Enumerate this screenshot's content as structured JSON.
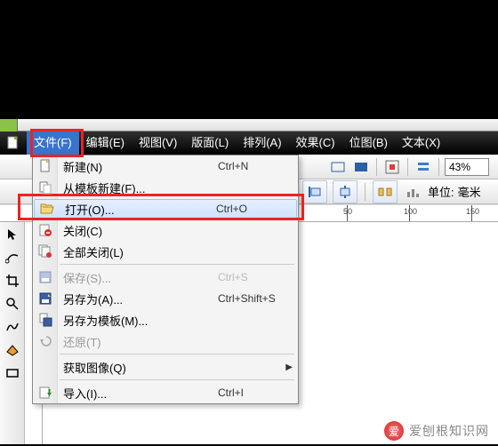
{
  "menubar": {
    "file": "文件(F)",
    "edit": "编辑(E)",
    "view": "视图(V)",
    "layout": "版面(L)",
    "arrange": "排列(A)",
    "effects": "效果(C)",
    "bitmap": "位图(B)",
    "text": "文本(X)"
  },
  "file_menu": {
    "new": {
      "label": "新建(N)",
      "shortcut": "Ctrl+N"
    },
    "new_from_template": {
      "label": "从模板新建(F)...",
      "shortcut": ""
    },
    "open": {
      "label": "打开(O)...",
      "shortcut": "Ctrl+O"
    },
    "close": {
      "label": "关闭(C)",
      "shortcut": ""
    },
    "close_all": {
      "label": "全部关闭(L)",
      "shortcut": ""
    },
    "save": {
      "label": "保存(S)...",
      "shortcut": "Ctrl+S"
    },
    "save_as": {
      "label": "另存为(A)...",
      "shortcut": "Ctrl+Shift+S"
    },
    "save_as_template": {
      "label": "另存为模板(M)...",
      "shortcut": ""
    },
    "revert": {
      "label": "还原(T)",
      "shortcut": ""
    },
    "acquire_image": {
      "label": "获取图像(Q)",
      "shortcut": ""
    },
    "import": {
      "label": "导入(I)...",
      "shortcut": "Ctrl+I"
    }
  },
  "toolbar": {
    "zoom": "43%",
    "unit_prefix": "单位:",
    "unit_value": "毫米"
  },
  "ruler": {
    "t50": "50",
    "t100": "100",
    "t150": "150"
  },
  "watermark": "爱刨根知识网"
}
